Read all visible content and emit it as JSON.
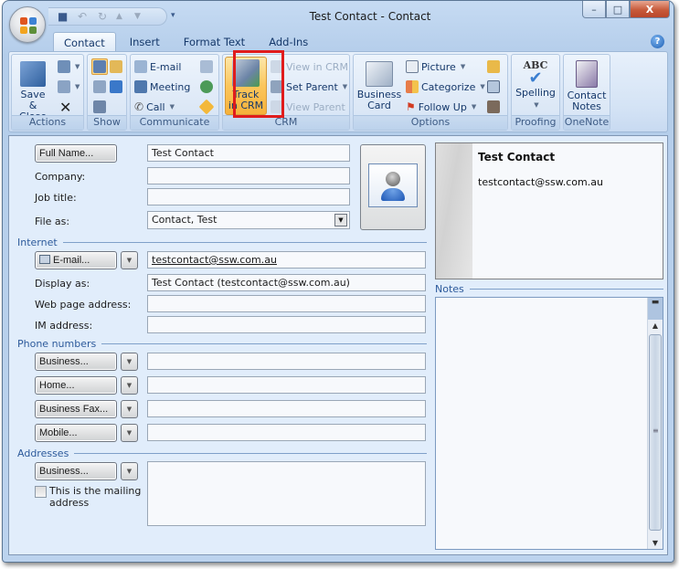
{
  "window": {
    "title": "Test Contact - Contact",
    "controls": {
      "minimize": "–",
      "maximize": "□",
      "close": "X"
    }
  },
  "quick_access": [
    "save-icon",
    "undo-icon",
    "redo-icon",
    "up-icon",
    "down-icon",
    "customize-icon"
  ],
  "tabs": [
    {
      "label": "Contact",
      "active": true
    },
    {
      "label": "Insert",
      "active": false
    },
    {
      "label": "Format Text",
      "active": false
    },
    {
      "label": "Add-Ins",
      "active": false
    }
  ],
  "help_label": "?",
  "ribbon": {
    "actions": {
      "label": "Actions",
      "save_close": "Save &\nClose",
      "save_close_l1": "Save &",
      "save_close_l2": "Close"
    },
    "show": {
      "label": "Show"
    },
    "communicate": {
      "label": "Communicate",
      "email": "E-mail",
      "meeting": "Meeting",
      "call": "Call"
    },
    "crm": {
      "label": "CRM",
      "track_l1": "Track",
      "track_l2": "in CRM",
      "view_in_crm": "View in CRM",
      "set_parent": "Set Parent",
      "view_parent": "View Parent"
    },
    "options": {
      "label": "Options",
      "business_l1": "Business",
      "business_l2": "Card",
      "picture": "Picture",
      "categorize": "Categorize",
      "follow_up": "Follow Up"
    },
    "proofing": {
      "label": "Proofing",
      "spelling": "Spelling"
    },
    "onenote": {
      "label": "OneNote",
      "notes_l1": "Contact",
      "notes_l2": "Notes"
    }
  },
  "form": {
    "full_name_button": "Full Name...",
    "full_name_value": "Test Contact",
    "company_label": "Company:",
    "company_value": "",
    "job_title_label": "Job title:",
    "job_title_value": "",
    "file_as_label": "File as:",
    "file_as_value": "Contact, Test",
    "internet_section": "Internet",
    "email_button": "E-mail...",
    "email_value": "testcontact@ssw.com.au",
    "display_as_label": "Display as:",
    "display_as_value": "Test Contact (testcontact@ssw.com.au)",
    "web_label": "Web page address:",
    "web_value": "",
    "im_label": "IM address:",
    "im_value": "",
    "phone_section": "Phone numbers",
    "phones": [
      {
        "label": "Business...",
        "value": ""
      },
      {
        "label": "Home...",
        "value": ""
      },
      {
        "label": "Business Fax...",
        "value": ""
      },
      {
        "label": "Mobile...",
        "value": ""
      }
    ],
    "addresses_section": "Addresses",
    "address_button": "Business...",
    "address_value": "",
    "mailing_checkbox": "This is the mailing address",
    "mailing_l1": "This is the mailing",
    "mailing_l2": "address",
    "mailing_checked": false
  },
  "business_card": {
    "name": "Test Contact",
    "email": "testcontact@ssw.com.au"
  },
  "notes": {
    "label": "Notes",
    "value": ""
  }
}
